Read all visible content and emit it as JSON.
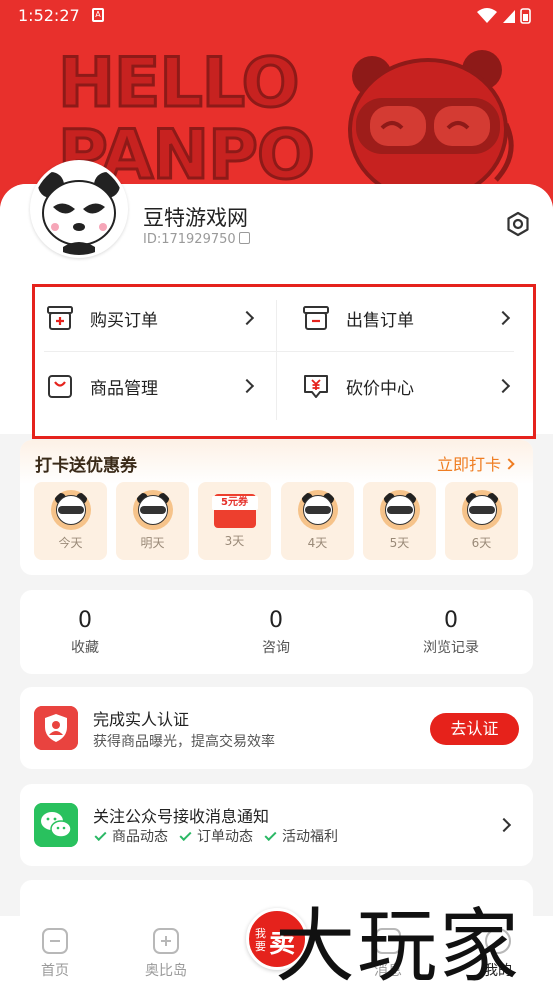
{
  "status_bar": {
    "time": "1:52:27",
    "app_icon": "A"
  },
  "banner": {
    "line1": "HELLO",
    "line2": "PANPO"
  },
  "profile": {
    "username": "豆特游戏网",
    "id_text": "ID:171929750"
  },
  "orders": {
    "items": [
      {
        "label": "购买订单",
        "icon": "buy-order-icon"
      },
      {
        "label": "出售订单",
        "icon": "sell-order-icon"
      },
      {
        "label": "商品管理",
        "icon": "product-manage-icon"
      },
      {
        "label": "砍价中心",
        "icon": "bargain-icon"
      }
    ]
  },
  "checkin": {
    "title": "打卡送优惠券",
    "action": "立即打卡",
    "coupon_text": "5元券",
    "days": [
      "今天",
      "明天",
      "3天",
      "4天",
      "5天",
      "6天"
    ]
  },
  "stats": [
    {
      "value": "0",
      "label": "收藏"
    },
    {
      "value": "0",
      "label": "咨询"
    },
    {
      "value": "0",
      "label": "浏览记录"
    }
  ],
  "verify": {
    "title": "完成实人认证",
    "subtitle": "获得商品曝光，提高交易效率",
    "button": "去认证"
  },
  "wechat": {
    "title": "关注公众号接收消息通知",
    "tags": [
      "商品动态",
      "订单动态",
      "活动福利"
    ]
  },
  "tabbar": {
    "tabs": [
      "首页",
      "奥比岛",
      "消息",
      "我的"
    ],
    "sell_small": "我要",
    "sell_big": "卖"
  },
  "watermark": "大玩家",
  "colors": {
    "brand_red": "#e5221c",
    "banner_red": "#e8302c",
    "checkin_orange": "#ef7d22",
    "wechat_green": "#29c15e"
  }
}
